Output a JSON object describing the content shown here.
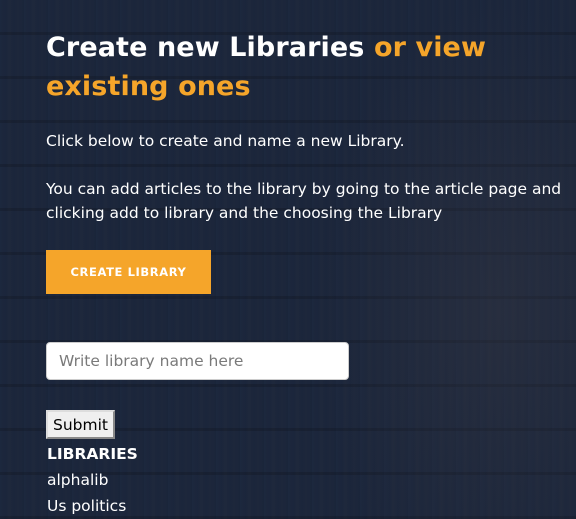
{
  "colors": {
    "accent": "#f5a52a",
    "overlay": "#18243c",
    "text": "#ffffff"
  },
  "heading": {
    "part1": "Create new Libraries ",
    "part2": "or view existing ones"
  },
  "intro": {
    "line1": "Click below to create and name a new Library.",
    "line2": "You can add articles to the library by going to the article page and clicking add to library and the choosing the Library"
  },
  "create_button": {
    "label": "CREATE LIBRARY"
  },
  "name_input": {
    "placeholder": "Write library name here",
    "value": ""
  },
  "submit_button": {
    "label": "Submit"
  },
  "libraries": {
    "heading": "LIBRARIES",
    "items": [
      "alphalib",
      "Us politics"
    ]
  }
}
